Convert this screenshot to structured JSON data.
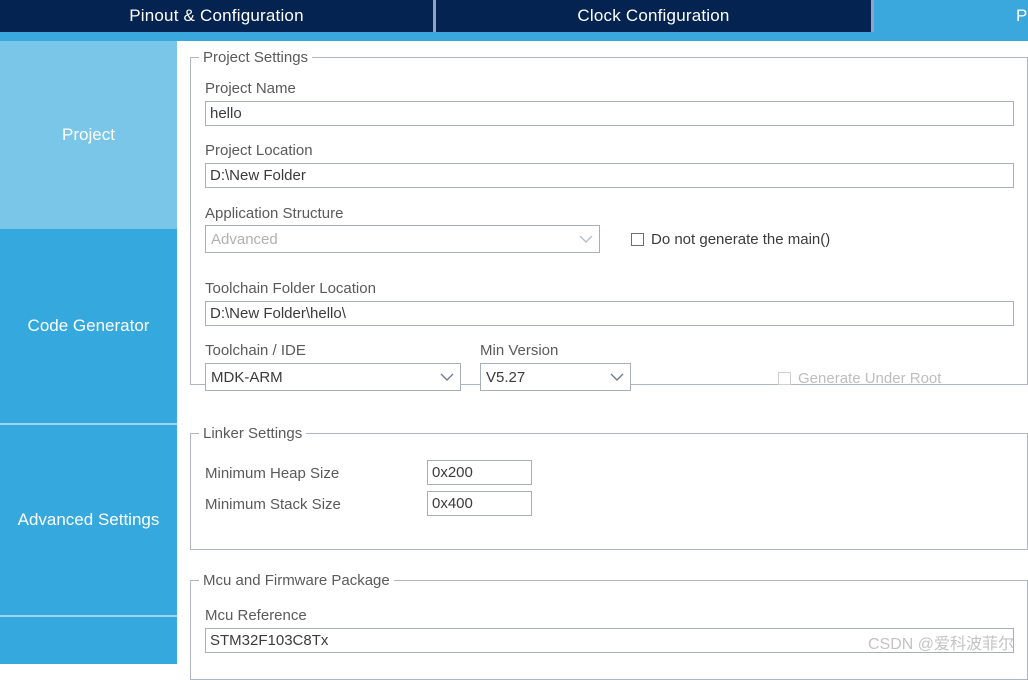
{
  "tabs": [
    {
      "label": "Pinout & Configuration",
      "active": false
    },
    {
      "label": "Clock Configuration",
      "active": false
    },
    {
      "label": "Pr",
      "active": true
    }
  ],
  "sidebar": {
    "items": [
      {
        "label": "Project",
        "selected": true
      },
      {
        "label": "Code Generator",
        "selected": false
      },
      {
        "label": "Advanced Settings",
        "selected": false
      },
      {
        "label": "",
        "selected": false
      }
    ]
  },
  "groups": {
    "project_settings": {
      "title": "Project Settings",
      "project_name": {
        "label": "Project Name",
        "value": "hello"
      },
      "project_location": {
        "label": "Project Location",
        "value": "D:\\New Folder"
      },
      "application_structure": {
        "label": "Application Structure",
        "value": "Advanced",
        "disabled": true
      },
      "do_not_generate_main": {
        "label": "Do not generate the main()",
        "checked": false,
        "disabled": false
      },
      "toolchain_folder_location": {
        "label": "Toolchain Folder Location",
        "value": "D:\\New Folder\\hello\\"
      },
      "toolchain_ide": {
        "label": "Toolchain / IDE",
        "value": "MDK-ARM",
        "disabled": false
      },
      "min_version": {
        "label": "Min Version",
        "value": "V5.27",
        "disabled": false
      },
      "generate_under_root": {
        "label": "Generate Under Root",
        "checked": false,
        "disabled": true
      }
    },
    "linker_settings": {
      "title": "Linker Settings",
      "min_heap_size": {
        "label": "Minimum Heap Size",
        "value": "0x200"
      },
      "min_stack_size": {
        "label": "Minimum Stack Size",
        "value": "0x400"
      }
    },
    "mcu_firmware_package": {
      "title": "Mcu and Firmware Package",
      "mcu_reference": {
        "label": "Mcu Reference",
        "value": "STM32F103C8Tx"
      }
    }
  },
  "watermark": "CSDN @爱科波菲尔",
  "colors": {
    "tab_bar_navy": "#042351",
    "accent_blue": "#35a8dd",
    "selected_blue": "#79c6e9",
    "tab_active_blue": "#3aa8dc",
    "label_gray": "#5a5a5a",
    "input_border": "#a7afbb",
    "group_border": "#aeb6c2",
    "disabled_gray": "#b0b0b0"
  }
}
